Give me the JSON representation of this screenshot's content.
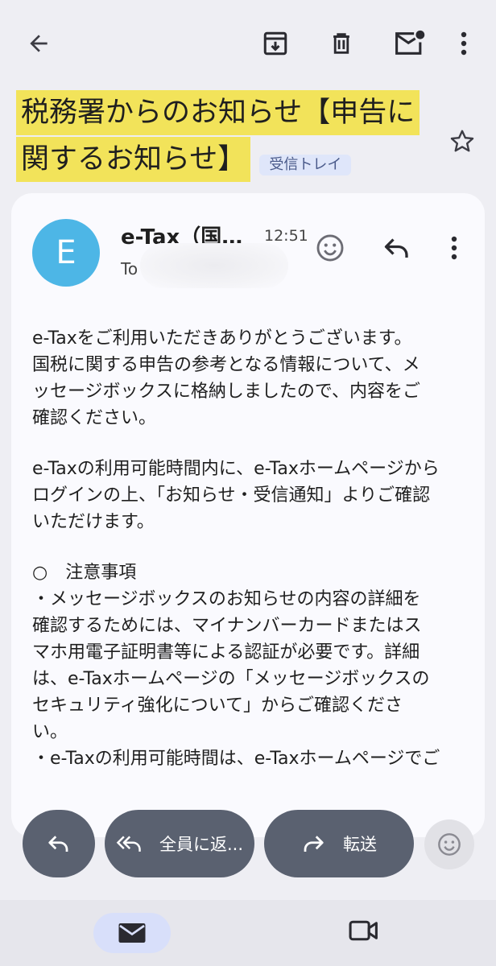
{
  "topbar": {
    "back_icon": "arrow-left-icon",
    "archive_icon": "archive-icon",
    "delete_icon": "trash-icon",
    "mark_unread_icon": "mail-unread-icon",
    "more_icon": "more-vert-icon"
  },
  "subject": {
    "line1": "税務署からのお知らせ【申告に",
    "line2": "関するお知らせ】",
    "label": "受信トレイ",
    "highlight_color": "#f2e35a"
  },
  "message": {
    "avatar_letter": "E",
    "avatar_color": "#4db6e6",
    "sender": "e-Tax（国…",
    "time": "12:51",
    "to_label": "To",
    "body": {
      "p1_l1": "e-Taxをご利用いただきありがとうございます。",
      "p1_l2": "国税に関する申告の参考となる情報について、メ",
      "p1_l3": "ッセージボックスに格納しましたので、内容をご",
      "p1_l4": "確認ください。",
      "p2_l1": "e-Taxの利用可能時間内に、e-Taxホームページから",
      "p2_l2": "ログインの上、「お知らせ・受信通知」よりご確認",
      "p2_l3": "いただけます。",
      "p3_l1": "○　注意事項",
      "p3_l2": "・メッセージボックスのお知らせの内容の詳細を",
      "p3_l3": "確認するためには、マイナンバーカードまたはス",
      "p3_l4": "マホ用電子証明書等による認証が必要です。詳細",
      "p3_l5": "は、e-Taxホームページの「メッセージボックスの",
      "p3_l6": "セキュリティ強化について」からご確認くださ",
      "p3_l7": "い。",
      "p3_l8": "・e-Taxの利用可能時間は、e-Taxホームページでご"
    }
  },
  "actions": {
    "reply_all_label": "全員に返...",
    "forward_label": "転送"
  },
  "colors": {
    "pill_bg": "#5a6170",
    "nav_active_bg": "#d8dffa"
  }
}
